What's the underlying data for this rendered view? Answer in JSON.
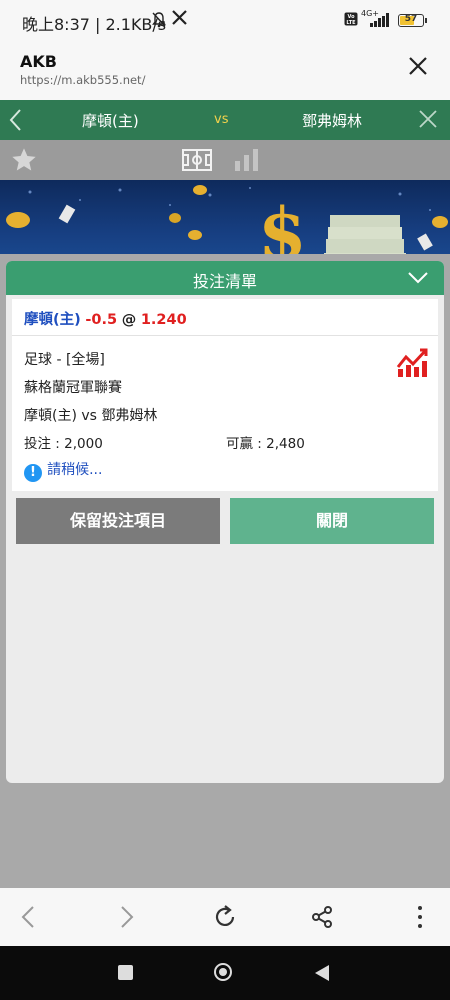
{
  "status_bar": {
    "time": "晚上8:37 | 2.1KB/s",
    "network": "4G+",
    "battery_level": "57"
  },
  "browser": {
    "title": "AKB",
    "url": "https://m.akb555.net/"
  },
  "match_header": {
    "home_team": "摩頓(主)",
    "vs": "vs",
    "away_team": "鄧弗姆林"
  },
  "bet_slip": {
    "title": "投注清單",
    "selection": {
      "team": "摩頓(主)",
      "handicap": "-0.5",
      "at": "@",
      "odds": "1.240"
    },
    "sport_line": "足球 - [全場]",
    "league": "蘇格蘭冠軍聯賽",
    "match": "摩頓(主) vs 鄧弗姆林",
    "stake": "投注 : 2,000",
    "potential_win": "可贏 : 2,480",
    "status": "請稍候..."
  },
  "buttons": {
    "keep": "保留投注項目",
    "close": "關閉"
  },
  "colors": {
    "match_header_bg": "#2f7a53",
    "slip_header_bg": "#3a9e70",
    "close_button_bg": "#5fb38e",
    "keep_button_bg": "#7b7b7b",
    "odds_red": "#e02020",
    "team_blue": "#1f4fbf"
  },
  "icons": {
    "status": [
      "bell-off-icon",
      "x-logo-icon",
      "signal-icon",
      "battery-icon"
    ],
    "browser": [
      "close-icon"
    ],
    "match": [
      "back-chevron-icon",
      "close-x-icon"
    ],
    "toolbar": [
      "star-icon",
      "pitch-icon",
      "stats-bars-icon"
    ],
    "slip": [
      "chevron-down-icon",
      "trend-chart-icon",
      "info-icon"
    ],
    "nav": [
      "back-icon",
      "forward-icon",
      "reload-icon",
      "share-icon",
      "more-icon"
    ],
    "system": [
      "recents-square-icon",
      "home-circle-icon",
      "back-triangle-icon"
    ]
  }
}
